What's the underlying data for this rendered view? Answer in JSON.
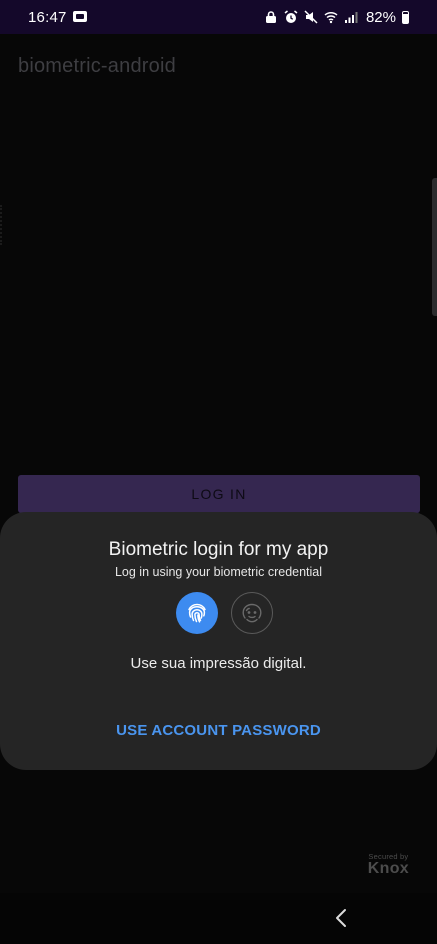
{
  "status_bar": {
    "time": "16:47",
    "battery": "82%",
    "icons": [
      "screenshot-icon",
      "lock-icon",
      "alarm-icon",
      "mute-icon",
      "wifi-icon",
      "signal-icon",
      "battery-icon"
    ]
  },
  "app": {
    "title": "biometric-android"
  },
  "login_button": {
    "label": "LOG IN"
  },
  "biometric_prompt": {
    "title": "Biometric login for my app",
    "subtitle": "Log in using your biometric credential",
    "instruction": "Use sua impressão digital.",
    "negative_button": "USE ACCOUNT PASSWORD",
    "options": [
      "fingerprint-icon",
      "face-icon"
    ],
    "accent_color": "#3d8bf0"
  },
  "knox": {
    "secured_by": "Secured by",
    "brand": "Knox"
  },
  "nav_bar": {
    "icons": [
      "back-icon"
    ]
  },
  "colors": {
    "background": "#070707",
    "status_bar": "#14082a",
    "login_button": "#352750",
    "sheet": "#252525",
    "link": "#4a95ef"
  }
}
